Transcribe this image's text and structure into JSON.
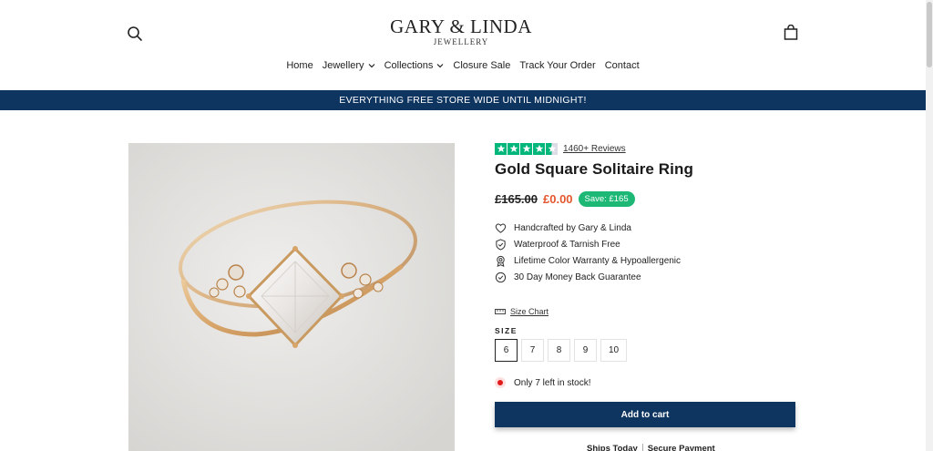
{
  "header": {
    "logo_main": "GARY & LINDA",
    "logo_sub": "JEWELLERY",
    "search_icon": "search-icon",
    "cart_icon": "bag-icon"
  },
  "nav": {
    "items": [
      {
        "label": "Home",
        "dropdown": false
      },
      {
        "label": "Jewellery",
        "dropdown": true
      },
      {
        "label": "Collections",
        "dropdown": true
      },
      {
        "label": "Closure Sale",
        "dropdown": false
      },
      {
        "label": "Track Your Order",
        "dropdown": false
      },
      {
        "label": "Contact",
        "dropdown": false
      }
    ]
  },
  "announcement": {
    "text": "EVERYTHING FREE STORE WIDE UNTIL MIDNIGHT!",
    "background": "#0e3460"
  },
  "product": {
    "rating_stars": 4.5,
    "reviews_label": "1460+ Reviews",
    "title": "Gold Square Solitaire Ring",
    "price_old": "£165.00",
    "price_new": "£0.00",
    "save_label": "Save: £165",
    "features": [
      {
        "icon": "heart-icon",
        "label": "Handcrafted by Gary & Linda"
      },
      {
        "icon": "shield-check-icon",
        "label": "Waterproof & Tarnish Free"
      },
      {
        "icon": "award-icon",
        "label": "Lifetime Color Warranty & Hypoallergenic"
      },
      {
        "icon": "check-circle-icon",
        "label": "30 Day Money Back Guarantee"
      }
    ],
    "size_chart_label": "Size Chart",
    "size_label": "SIZE",
    "sizes": [
      "6",
      "7",
      "8",
      "9",
      "10"
    ],
    "selected_size": "6",
    "stock_text": "Only 7 left in stock!",
    "add_to_cart_label": "Add to cart",
    "trust": [
      "Ships Today",
      "Secure Payment"
    ]
  },
  "colors": {
    "navy": "#0e3460",
    "sale_red": "#e4572e",
    "save_green": "#1db876",
    "trustpilot_green": "#00b67a"
  }
}
